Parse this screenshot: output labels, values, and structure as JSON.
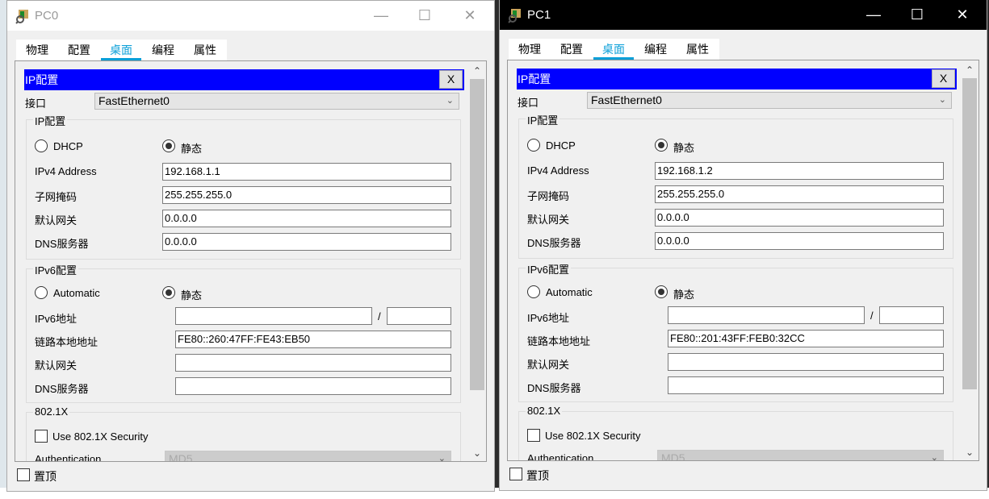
{
  "windows": [
    {
      "title": "PC0",
      "active": false,
      "tabs": [
        "物理",
        "配置",
        "桌面",
        "编程",
        "属性"
      ],
      "active_tab": "桌面",
      "header": "IP配置",
      "header_close": "X",
      "interface_label": "接口",
      "interface_value": "FastEthernet0",
      "ipv4": {
        "legend": "IP配置",
        "dhcp": "DHCP",
        "static": "静态",
        "mode": "static",
        "rows": [
          {
            "label": "IPv4 Address",
            "value": "192.168.1.1"
          },
          {
            "label": "子网掩码",
            "value": "255.255.255.0"
          },
          {
            "label": "默认网关",
            "value": "0.0.0.0"
          },
          {
            "label": "DNS服务器",
            "value": "0.0.0.0"
          }
        ]
      },
      "ipv6": {
        "legend": "IPv6配置",
        "auto": "Automatic",
        "static": "静态",
        "mode": "static",
        "slash": "/",
        "addr_label": "IPv6地址",
        "addr_value": "",
        "prefix_value": "",
        "rows": [
          {
            "label": "链路本地地址",
            "value": "FE80::260:47FF:FE43:EB50"
          },
          {
            "label": "默认网关",
            "value": ""
          },
          {
            "label": "DNS服务器",
            "value": ""
          }
        ]
      },
      "dot1x": {
        "legend": "802.1X",
        "use_label": "Use 802.1X Security",
        "checked": false,
        "auth_label": "Authentication",
        "auth_value": "MD5"
      },
      "pin_label": "置顶",
      "pinned": false
    },
    {
      "title": "PC1",
      "active": true,
      "tabs": [
        "物理",
        "配置",
        "桌面",
        "编程",
        "属性"
      ],
      "active_tab": "桌面",
      "header": "IP配置",
      "header_close": "X",
      "interface_label": "接口",
      "interface_value": "FastEthernet0",
      "ipv4": {
        "legend": "IP配置",
        "dhcp": "DHCP",
        "static": "静态",
        "mode": "static",
        "rows": [
          {
            "label": "IPv4 Address",
            "value": "192.168.1.2"
          },
          {
            "label": "子网掩码",
            "value": "255.255.255.0"
          },
          {
            "label": "默认网关",
            "value": "0.0.0.0"
          },
          {
            "label": "DNS服务器",
            "value": "0.0.0.0"
          }
        ]
      },
      "ipv6": {
        "legend": "IPv6配置",
        "auto": "Automatic",
        "static": "静态",
        "mode": "static",
        "slash": "/",
        "addr_label": "IPv6地址",
        "addr_value": "",
        "prefix_value": "",
        "rows": [
          {
            "label": "链路本地地址",
            "value": "FE80::201:43FF:FEB0:32CC"
          },
          {
            "label": "默认网关",
            "value": ""
          },
          {
            "label": "DNS服务器",
            "value": ""
          }
        ]
      },
      "dot1x": {
        "legend": "802.1X",
        "use_label": "Use 802.1X Security",
        "checked": false,
        "auth_label": "Authentication",
        "auth_value": "MD5"
      },
      "pin_label": "置顶",
      "pinned": false
    }
  ],
  "colors": {
    "header_bg": "#0000ff",
    "tab_accent": "#0a9fd8"
  }
}
